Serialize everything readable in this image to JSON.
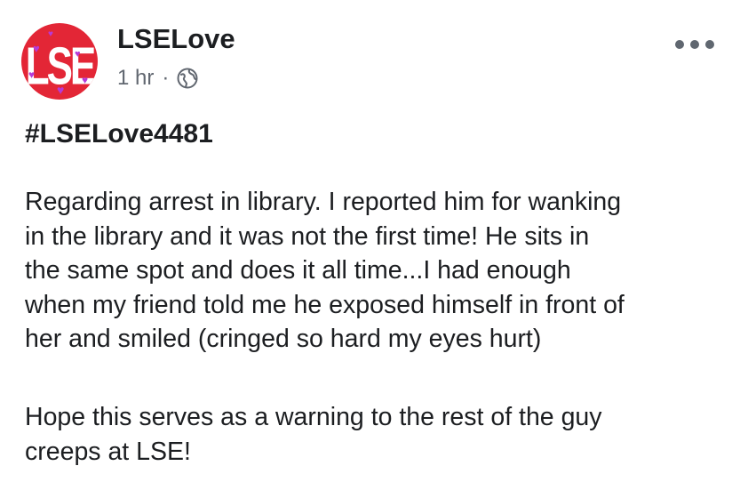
{
  "post": {
    "avatar": {
      "logo_text": "LSE",
      "bg_color": "#e32636",
      "heart_color": "#b63ad8"
    },
    "author_name": "LSELove",
    "timestamp": "1 hr",
    "separator": "·",
    "privacy_icon": "globe-icon",
    "more_icon": "more-options-icon",
    "hashtag": "#LSELove4481",
    "body": {
      "paragraph1": [
        "Regarding arrest in library. I reported him for wanking",
        "in the library and it was not the first time! He sits in",
        "the same spot and does it all time...I had enough",
        "when my friend told me he exposed himself in front of",
        "her and smiled (cringed so hard my eyes hurt)"
      ],
      "paragraph2": [
        "Hope this serves as a warning to the rest of the guy",
        "creeps at LSE!"
      ]
    }
  }
}
